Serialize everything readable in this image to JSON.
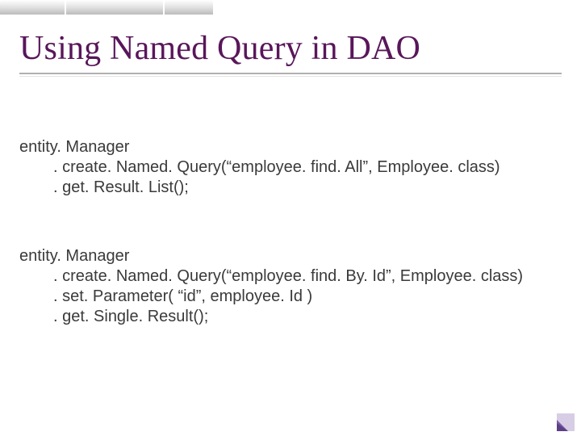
{
  "title": "Using Named Query in DAO",
  "code1": {
    "l1": "entity. Manager",
    "l2": ". create. Named. Query(“employee. find. All”, Employee. class)",
    "l3": ". get. Result. List();"
  },
  "code2": {
    "l1": "entity. Manager",
    "l2": ". create. Named. Query(“employee. find. By. Id”, Employee. class)",
    "l3": ". set. Parameter( “id”, employee. Id )",
    "l4": ". get. Single. Result();"
  }
}
